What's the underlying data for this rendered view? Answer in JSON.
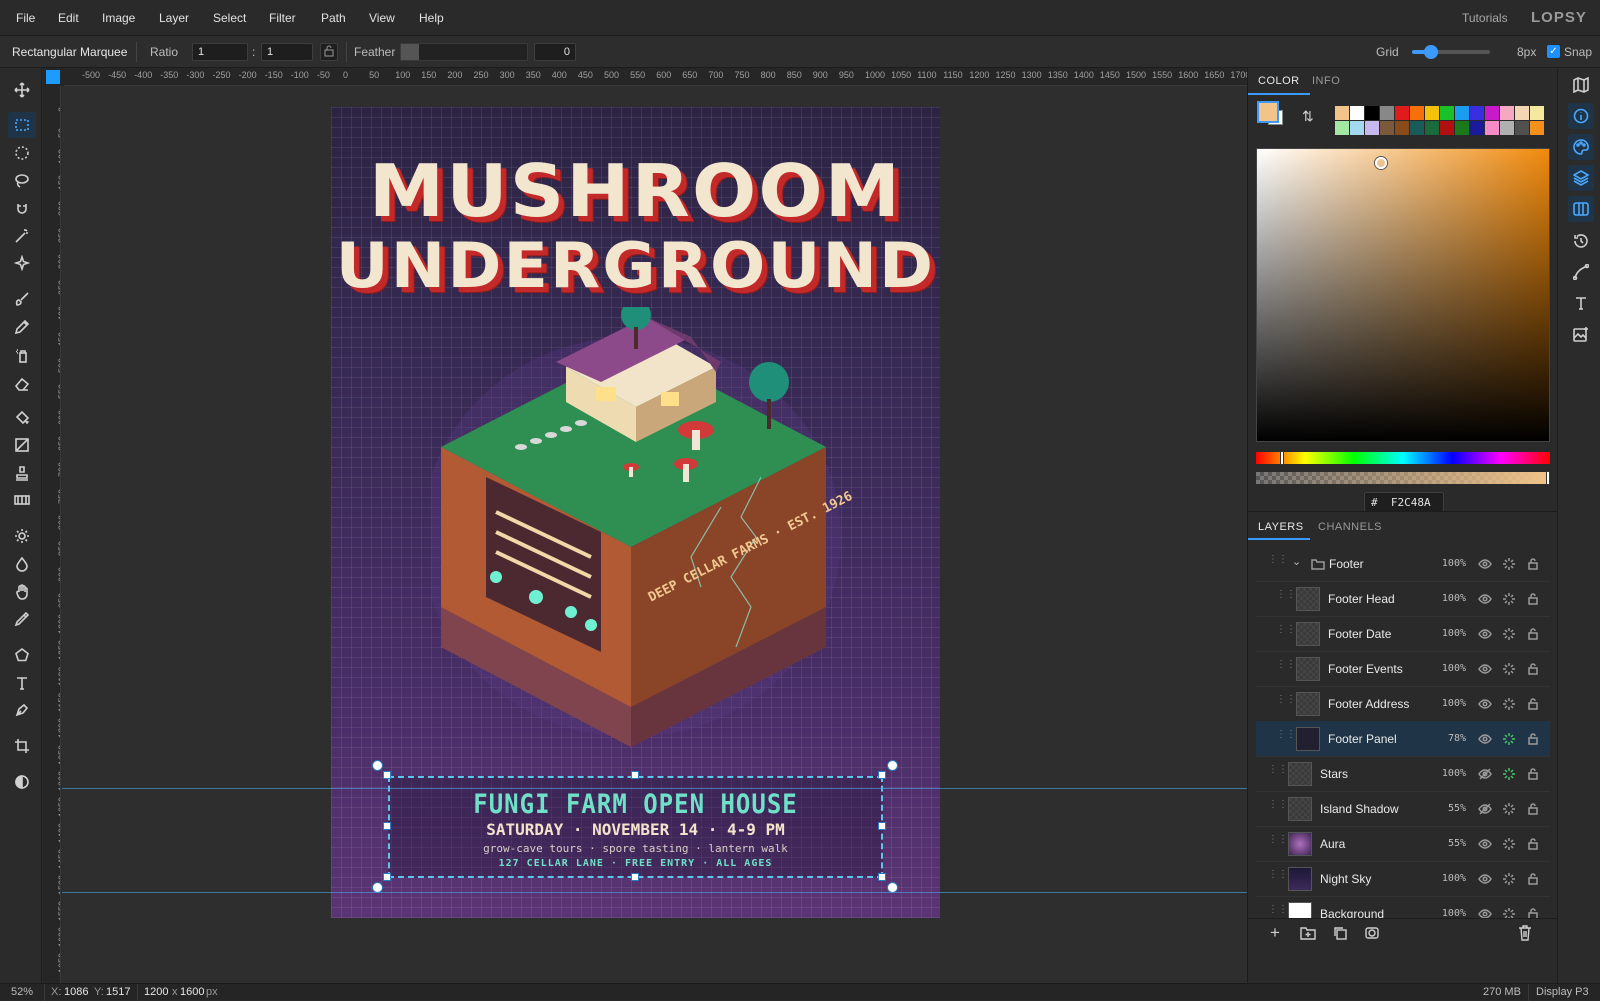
{
  "menu": {
    "items": [
      "File",
      "Edit",
      "Image",
      "Layer",
      "Select",
      "Filter",
      "Path",
      "View",
      "Help"
    ],
    "tutorials": "Tutorials",
    "logo": "LOPSY"
  },
  "options": {
    "tool_name": "Rectangular Marquee",
    "ratio_label": "Ratio",
    "ratio_w": "1",
    "ratio_sep": ":",
    "ratio_h": "1",
    "feather_label": "Feather",
    "feather_value": "0",
    "grid_label": "Grid",
    "grid_value": "8px",
    "snap_label": "Snap",
    "snap_checked": true
  },
  "ruler": {
    "top": [
      "-500",
      "-450",
      "-400",
      "-350",
      "-300",
      "-250",
      "-200",
      "-150",
      "-100",
      "-50",
      "0",
      "50",
      "100",
      "150",
      "200",
      "250",
      "300",
      "350",
      "400",
      "450",
      "500",
      "550",
      "600",
      "650",
      "700",
      "750",
      "800",
      "850",
      "900",
      "950",
      "1000",
      "1050",
      "1100",
      "1150",
      "1200",
      "1250",
      "1300",
      "1350",
      "1400",
      "1450",
      "1500",
      "1550",
      "1600",
      "1650",
      "1700"
    ],
    "left": [
      "0",
      "50",
      "100",
      "150",
      "200",
      "250",
      "300",
      "350",
      "400",
      "450",
      "500",
      "550",
      "600",
      "650",
      "700",
      "750",
      "800",
      "850",
      "900",
      "950",
      "1000",
      "1050",
      "1100",
      "1150",
      "1200",
      "1250",
      "1300",
      "1350",
      "1400",
      "1450",
      "1500",
      "1550",
      "1600",
      "1650"
    ]
  },
  "poster": {
    "title1": "MUSHROOM",
    "title2": "UNDERGROUND",
    "sign": "DEEP CELLAR FARMS · EST. 1926",
    "footer_title": "FUNGI FARM OPEN HOUSE",
    "footer_date": "SATURDAY · NOVEMBER 14 · 4-9 PM",
    "footer_events": "grow-cave tours  ·  spore tasting  ·  lantern walk",
    "footer_address": "127 CELLAR LANE  ·  FREE ENTRY  ·  ALL AGES"
  },
  "panel": {
    "tab_color": "COLOR",
    "tab_info": "INFO",
    "hex_prefix": "#",
    "hex": "F2C48A",
    "tab_layers": "LAYERS",
    "tab_channels": "CHANNELS",
    "fg_color": "#f2c48a",
    "bg_color": "#ffffff",
    "swatches": [
      "#f2c48a",
      "#ffffff",
      "#000000",
      "#888888",
      "#e01b1b",
      "#f5700a",
      "#f5c20a",
      "#19c22b",
      "#1a9cf0",
      "#3a2fe0",
      "#c81ac8",
      "#f5a8c2",
      "#f5d6b4",
      "#f5e9a0",
      "#a4e8a4",
      "#a4d8f0",
      "#c8b8f0",
      "#7a5a3a",
      "#8a4a1a",
      "#1a5a5a",
      "#1a6a3a",
      "#b01010",
      "#1a7a1a",
      "#1a1a9a",
      "#f58ac8",
      "#b0b0b0",
      "#505050",
      "#f5901a"
    ]
  },
  "layers": [
    {
      "name": "Footer",
      "opacity": "100%",
      "type": "group",
      "visible": true,
      "fx": false,
      "thumb": "folder"
    },
    {
      "name": "Footer Head",
      "opacity": "100%",
      "visible": true,
      "fx": false,
      "indent": true,
      "thumb": "text"
    },
    {
      "name": "Footer Date",
      "opacity": "100%",
      "visible": true,
      "fx": false,
      "indent": true,
      "thumb": "text"
    },
    {
      "name": "Footer Events",
      "opacity": "100%",
      "visible": true,
      "fx": false,
      "indent": true,
      "thumb": "empty"
    },
    {
      "name": "Footer Address",
      "opacity": "100%",
      "visible": true,
      "fx": false,
      "indent": true,
      "thumb": "empty"
    },
    {
      "name": "Footer Panel",
      "opacity": "78%",
      "visible": true,
      "fx": true,
      "indent": true,
      "selected": true,
      "thumb": "dark"
    },
    {
      "name": "Stars",
      "opacity": "100%",
      "visible": false,
      "fx": true,
      "thumb": "empty"
    },
    {
      "name": "Island Shadow",
      "opacity": "55%",
      "visible": false,
      "fx": false,
      "thumb": "empty"
    },
    {
      "name": "Aura",
      "opacity": "55%",
      "visible": true,
      "fx": false,
      "thumb": "aura"
    },
    {
      "name": "Night Sky",
      "opacity": "100%",
      "visible": true,
      "fx": false,
      "thumb": "sky"
    },
    {
      "name": "Background",
      "opacity": "100%",
      "visible": true,
      "fx": false,
      "thumb": "white"
    }
  ],
  "status": {
    "zoom": "52%",
    "x_label": "X:",
    "x": "1086",
    "y_label": "Y:",
    "y": "1517",
    "size_w": "1200",
    "size_x": "x",
    "size_h": "1600",
    "size_unit": "px",
    "memory": "270 MB",
    "display": "Display P3"
  }
}
